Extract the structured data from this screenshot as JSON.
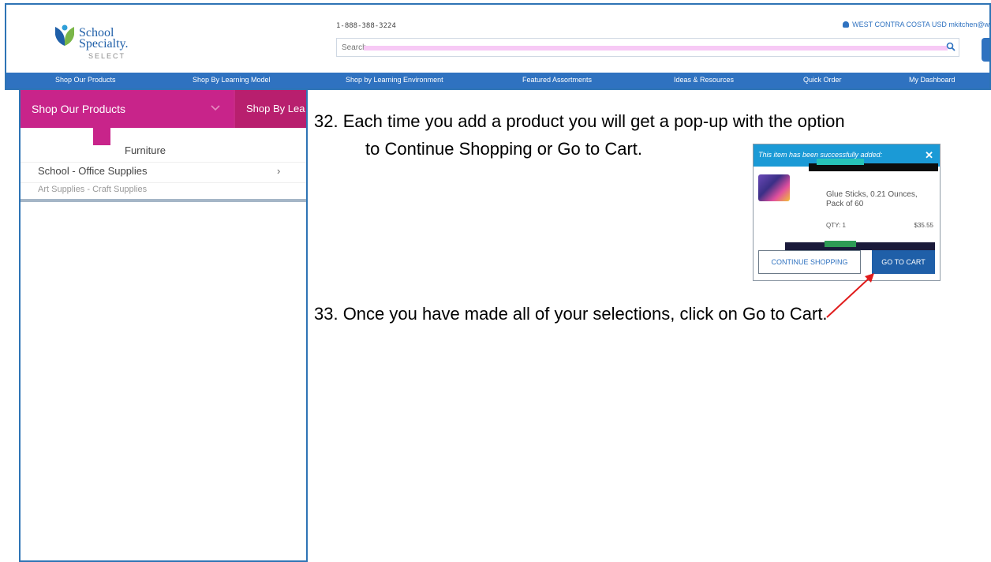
{
  "site": {
    "logo": {
      "line1": "School",
      "line2": "Specialty.",
      "line3": "SELECT"
    },
    "phone": "1-888-388-3224",
    "account": "WEST CONTRA COSTA USD mkitchen@w",
    "search": {
      "placeholder": "Search"
    },
    "nav": [
      "Shop Our Products",
      "Shop By Learning Model",
      "Shop by Learning Environment",
      "Featured Assortments",
      "Ideas & Resources",
      "Quick Order",
      "My Dashboard"
    ]
  },
  "menu": {
    "tab_active": "Shop Our Products",
    "tab_next": "Shop By Lea",
    "items": [
      {
        "label": "Furniture"
      },
      {
        "label": "School - Office Supplies",
        "chevron": "›"
      },
      {
        "label": "Art Supplies - Craft Supplies"
      }
    ]
  },
  "instructions": {
    "step_32_line1": "32. Each time you add a product you will get a pop-up with the option",
    "step_32_line2": "to Continue Shopping or Go to Cart.",
    "step_33": "33. Once you have made all of your selections, click on Go to Cart."
  },
  "popup": {
    "header": "This item has been successfully added:",
    "close": "✕",
    "product_name": "Glue Sticks, 0.21 Ounces, Pack of 60",
    "qty": "QTY: 1",
    "price": "$35.55",
    "continue_label": "CONTINUE SHOPPING",
    "cart_label": "GO TO CART"
  },
  "colors": {
    "frame_border": "#2e74b5",
    "nav_bg": "#2f72c0",
    "menu_magenta": "#c8248a",
    "popup_header": "#1b9ad6",
    "cart_button": "#1f5fa8",
    "arrow": "#e01b1b"
  }
}
